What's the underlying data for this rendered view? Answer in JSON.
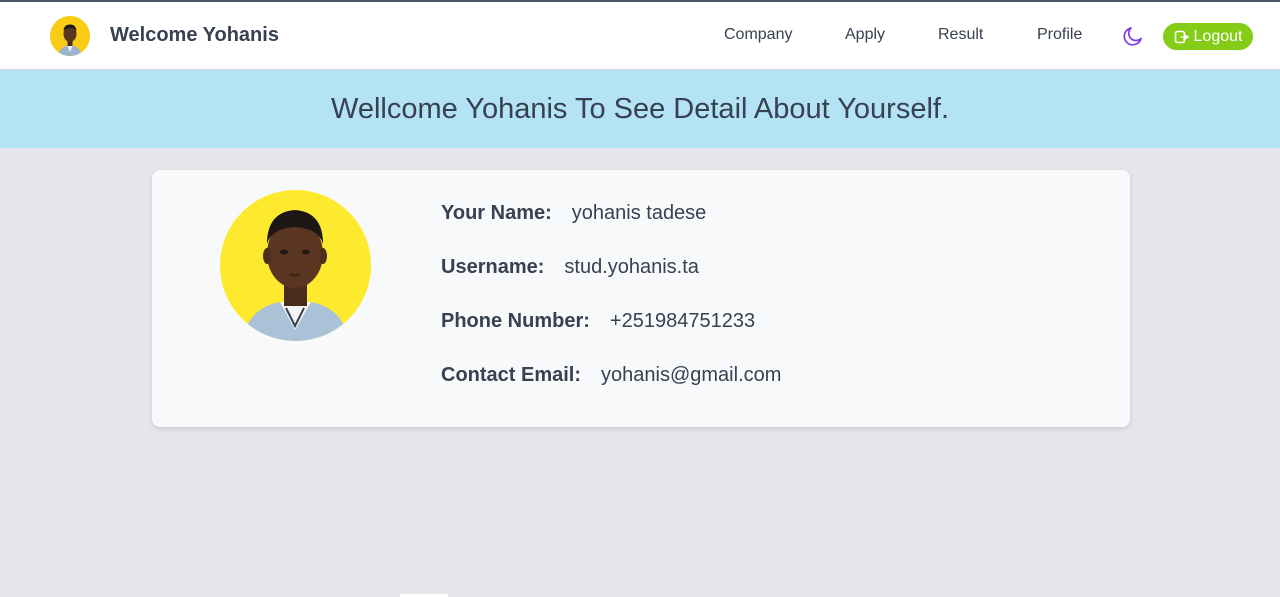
{
  "header": {
    "brand_title": "Welcome Yohanis",
    "nav": {
      "company": "Company",
      "apply": "Apply",
      "result": "Result",
      "profile": "Profile"
    },
    "theme_icon": "moon-icon",
    "logout_label": "Logout",
    "logout_icon": "logout-icon"
  },
  "banner": {
    "text": "Wellcome Yohanis To See Detail About Yourself."
  },
  "profile": {
    "fields": [
      {
        "label": "Your Name:",
        "value": "yohanis tadese"
      },
      {
        "label": "Username:",
        "value": "stud.yohanis.ta"
      },
      {
        "label": "Phone Number:",
        "value": "+251984751233"
      },
      {
        "label": "Contact Email:",
        "value": "yohanis@gmail.com"
      }
    ]
  },
  "colors": {
    "logout_bg": "#84cc16",
    "banner_bg": "#b3e3f5",
    "avatar_bg": "#fde92e",
    "moon_icon": "#7c3aed",
    "page_bg": "#e5e7eb"
  }
}
